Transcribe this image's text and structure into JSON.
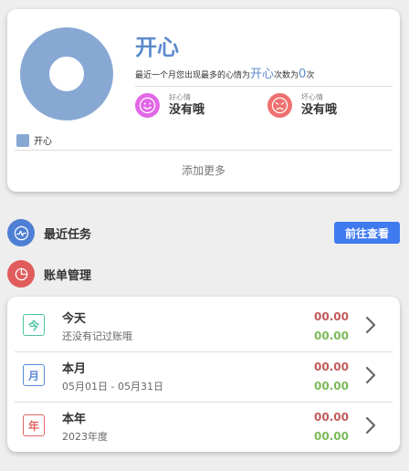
{
  "mood_card": {
    "title": "开心",
    "summary_prefix": "最近一个月您出现最多的心情为",
    "summary_mood": "开心",
    "summary_mid": "次数为",
    "summary_count": "0",
    "summary_suffix": "次",
    "legend_label": "开心",
    "good_caption": "好心情",
    "good_value": "没有哦",
    "bad_caption": "坏心情",
    "bad_value": "没有哦",
    "add_more": "添加更多"
  },
  "sections": {
    "recent_tasks": "最近任务",
    "go_view": "前往查看",
    "bill_manage": "账单管理"
  },
  "bills": [
    {
      "badge": "今",
      "title": "今天",
      "subtitle": "还没有记过账哦",
      "expense": "00.00",
      "income": "00.00",
      "color": "#4fc3a6"
    },
    {
      "badge": "月",
      "title": "本月",
      "subtitle": "05月01日 - 05月31日",
      "expense": "00.00",
      "income": "00.00",
      "color": "#5b8ad6"
    },
    {
      "badge": "年",
      "title": "本年",
      "subtitle": "2023年度",
      "expense": "00.00",
      "income": "00.00",
      "color": "#e06666"
    }
  ],
  "colors": {
    "donut": "#88a8d4",
    "accent": "#5d8acd",
    "good_face": "#e168e6",
    "bad_face": "#ef7070",
    "recent_icon": "#4f7fd4",
    "bill_icon": "#e05c5c",
    "expense": "#c25b5b",
    "income": "#7cba5a",
    "chevron": "#666666"
  },
  "icons": {
    "good": "smile-face-icon",
    "bad": "sad-face-icon",
    "recent": "activity-pulse-icon",
    "bill": "pie-chart-icon",
    "row": "chevron-right-icon"
  }
}
